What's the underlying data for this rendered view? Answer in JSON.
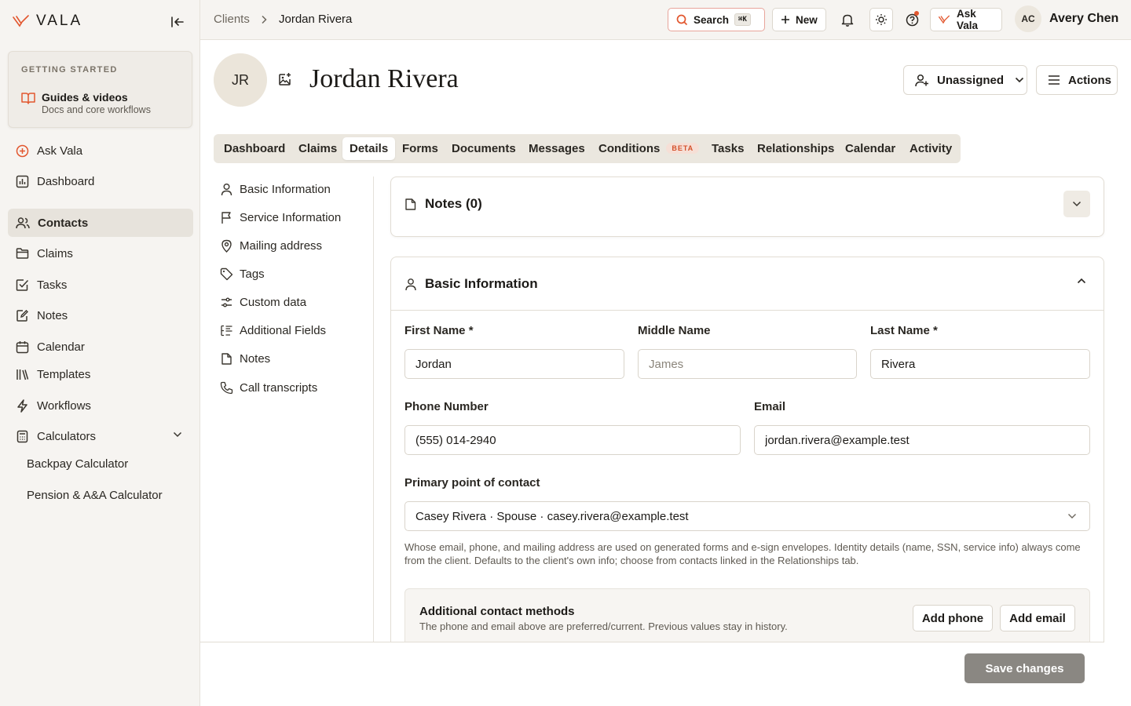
{
  "brand": {
    "name": "VALA",
    "accent": "#e2572f"
  },
  "sidebar": {
    "getting_started": {
      "label": "GETTING STARTED",
      "title": "Guides & videos",
      "subtitle": "Docs and core workflows"
    },
    "items": [
      {
        "label": "Ask Vala",
        "icon": "plus-circle-icon"
      },
      {
        "label": "Dashboard",
        "icon": "chart-icon"
      },
      {
        "label": "Contacts",
        "icon": "users-icon",
        "active": true
      },
      {
        "label": "Claims",
        "icon": "folder-icon"
      },
      {
        "label": "Tasks",
        "icon": "check-square-icon"
      },
      {
        "label": "Notes",
        "icon": "note-edit-icon"
      },
      {
        "label": "Calendar",
        "icon": "calendar-icon"
      },
      {
        "label": "Templates",
        "icon": "library-icon"
      },
      {
        "label": "Workflows",
        "icon": "lightning-icon"
      },
      {
        "label": "Calculators",
        "icon": "calculator-icon"
      }
    ],
    "subitems": [
      "Backpay Calculator",
      "Pension & A&A Calculator"
    ]
  },
  "topbar": {
    "breadcrumb": [
      "Clients",
      "Jordan Rivera"
    ],
    "search_label": "Search",
    "search_shortcut": "⌘K",
    "new_label": "New",
    "ask_label": "Ask Vala",
    "user_initials": "AC",
    "user_name": "Avery Chen"
  },
  "client": {
    "initials": "JR",
    "name": "Jordan Rivera",
    "assignee": "Unassigned",
    "actions_label": "Actions"
  },
  "tabs": [
    {
      "label": "Dashboard"
    },
    {
      "label": "Claims"
    },
    {
      "label": "Details",
      "active": true
    },
    {
      "label": "Forms"
    },
    {
      "label": "Documents"
    },
    {
      "label": "Messages"
    },
    {
      "label": "Conditions",
      "badge": "BETA"
    },
    {
      "label": "Tasks"
    },
    {
      "label": "Relationships"
    },
    {
      "label": "Calendar"
    },
    {
      "label": "Activity"
    }
  ],
  "sections": [
    {
      "label": "Basic Information",
      "icon": "user-icon"
    },
    {
      "label": "Service Information",
      "icon": "flag-icon"
    },
    {
      "label": "Mailing address",
      "icon": "map-pin-icon"
    },
    {
      "label": "Tags",
      "icon": "tag-icon"
    },
    {
      "label": "Custom data",
      "icon": "sliders-icon"
    },
    {
      "label": "Additional Fields",
      "icon": "list-icon"
    },
    {
      "label": "Notes",
      "icon": "file-icon"
    },
    {
      "label": "Call transcripts",
      "icon": "phone-icon"
    }
  ],
  "notes_card": {
    "title": "Notes (0)"
  },
  "basic_info": {
    "title": "Basic Information",
    "first_name": {
      "label": "First Name *",
      "value": "Jordan"
    },
    "middle_name": {
      "label": "Middle Name",
      "value": "",
      "placeholder": "James"
    },
    "last_name": {
      "label": "Last Name *",
      "value": "Rivera"
    },
    "phone": {
      "label": "Phone Number",
      "value": "(555) 014-2940"
    },
    "email": {
      "label": "Email",
      "value": "jordan.rivera@example.test"
    },
    "primary_contact": {
      "label": "Primary point of contact",
      "value": "Casey Rivera · Spouse · casey.rivera@example.test",
      "help": "Whose email, phone, and mailing address are used on generated forms and e-sign envelopes. Identity details (name, SSN, service info) always come from the client. Defaults to the client's own info; choose from contacts linked in the Relationships tab."
    },
    "additional_methods": {
      "title": "Additional contact methods",
      "subtitle": "The phone and email above are preferred/current. Previous values stay in history.",
      "add_phone": "Add phone",
      "add_email": "Add email"
    }
  },
  "footer": {
    "save_label": "Save changes"
  }
}
